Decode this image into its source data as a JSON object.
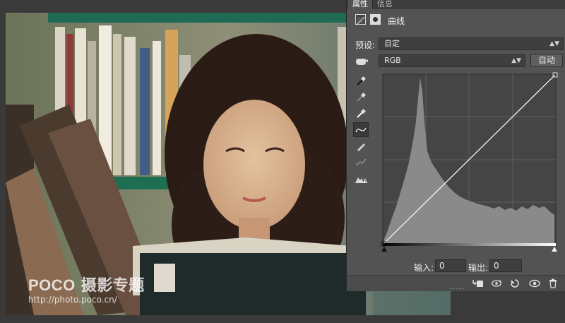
{
  "panel": {
    "tabs": [
      {
        "label": "属性",
        "active": true
      },
      {
        "label": "信息",
        "active": false
      }
    ],
    "title": "曲线",
    "preset_label": "预设:",
    "preset_value": "自定",
    "channel_value": "RGB",
    "auto_label": "自动",
    "input_label": "输入:",
    "input_value": "0",
    "output_label": "输出:",
    "output_value": "0"
  },
  "tools": [
    "sample-in-image-black-point-icon",
    "sample-in-image-gray-point-icon",
    "sample-in-image-white-point-icon",
    "edit-points-curve-icon",
    "draw-freehand-pencil-icon",
    "smooth-curve-icon",
    "clipping-warning-icon"
  ],
  "bottom_icons": [
    "clip-to-layer-icon",
    "view-previous-state-icon",
    "reset-icon",
    "toggle-visibility-icon",
    "delete-icon"
  ],
  "watermark": {
    "brand": "POCO",
    "subtitle": "摄影专题",
    "url": "http://photo.poco.cn/"
  },
  "colors": {
    "panel_bg": "#535353",
    "graph_bg": "#454545",
    "histogram": "#8a8a8a",
    "curve": "#ffffff"
  }
}
